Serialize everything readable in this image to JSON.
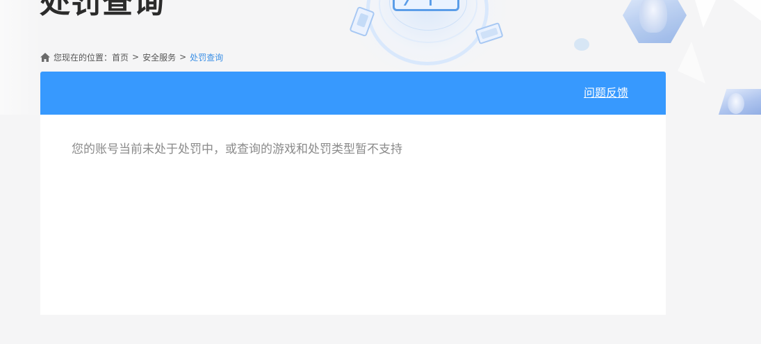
{
  "page": {
    "title": "处罚查询"
  },
  "breadcrumb": {
    "prefix": "您现在的位置：",
    "items": [
      {
        "label": "首页"
      },
      {
        "label": "安全服务"
      },
      {
        "label": "处罚查询"
      }
    ],
    "separator": ">"
  },
  "panel": {
    "header_color": "#3799fe",
    "feedback_link": "问题反馈",
    "notice": "您的账号当前未处于处罚中，或查询的游戏和处罚类型暂不支持"
  }
}
